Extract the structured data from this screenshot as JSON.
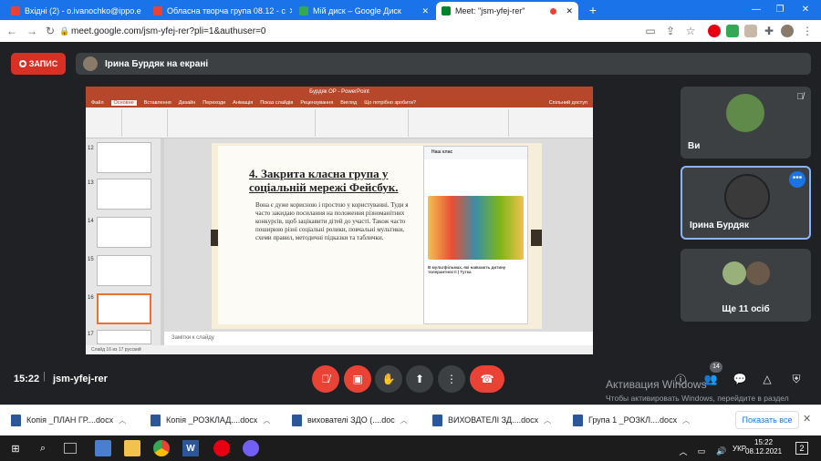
{
  "tabs": [
    {
      "title": "Вхідні (2) - o.ivanochko@ippo.e",
      "favcolor": "#ea4335"
    },
    {
      "title": "Обласна творча група 08.12 - с",
      "favcolor": "#ea4335"
    },
    {
      "title": "Мій диск – Google Диск",
      "favcolor": "#34a853"
    },
    {
      "title": "Meet: \"jsm-yfej-rer\"",
      "favcolor": "#00832d"
    }
  ],
  "url": "meet.google.com/jsm-yfej-rer?pli=1&authuser=0",
  "meet": {
    "record_label": "ЗАПИС",
    "presenter_label": "Ірина Бурдяк на екрані",
    "time": "15:22",
    "separator": "|",
    "code": "jsm-yfej-rer",
    "people_badge": "14"
  },
  "tiles": [
    {
      "name": "Ви"
    },
    {
      "name": "Ірина Бурдяк"
    },
    {
      "name": "Ще 11 осіб"
    }
  ],
  "ppt": {
    "window_title": "Бурдяк ОР - PowerPoint",
    "menu": [
      "Файл",
      "Основне",
      "Вставлення",
      "Дизайн",
      "Переходи",
      "Анімація",
      "Показ слайдів",
      "Рецензування",
      "Вигляд",
      "Що потрібно зробити?"
    ],
    "share": "Спільний доступ",
    "slide_numbers": [
      "12",
      "13",
      "14",
      "15",
      "16",
      "17"
    ],
    "slide_title": "4. Закрита класна група у соціальній мережі Фейсбук.",
    "slide_body": "Вона є дуже корисною і простою у користуванні. Туди я часто закидаю посилання на положення різноманітних конкурсів, щоб зацікавити дітей до участі. Також часто поширюю різні соціальні ролики, повчальні мультики, схеми правил, методичні підказки та таблички.",
    "fb_header": "Наш клас",
    "fb_post_title": "В мультфільмах, які навчають дитину толерантності | Тутка",
    "notes": "Замітки к слайду",
    "status": "Слайд 16 из 17   русский"
  },
  "activation": {
    "line1": "Активация Windows",
    "line2": "Чтобы активировать Windows, перейдите в раздел \"Параметры\"."
  },
  "downloads": [
    {
      "name": "Копія _ПЛАН ГР....docx"
    },
    {
      "name": "Копія _РОЗКЛАД....docx"
    },
    {
      "name": "вихователі ЗДО (....doc"
    },
    {
      "name": "ВИХОВАТЕЛІ ЗД....docx"
    },
    {
      "name": "Група 1 _РОЗКЛ....docx"
    }
  ],
  "show_all": "Показать все",
  "taskbar": {
    "lang": "УКР",
    "time": "15:22",
    "date": "08.12.2021",
    "notif": "2"
  }
}
